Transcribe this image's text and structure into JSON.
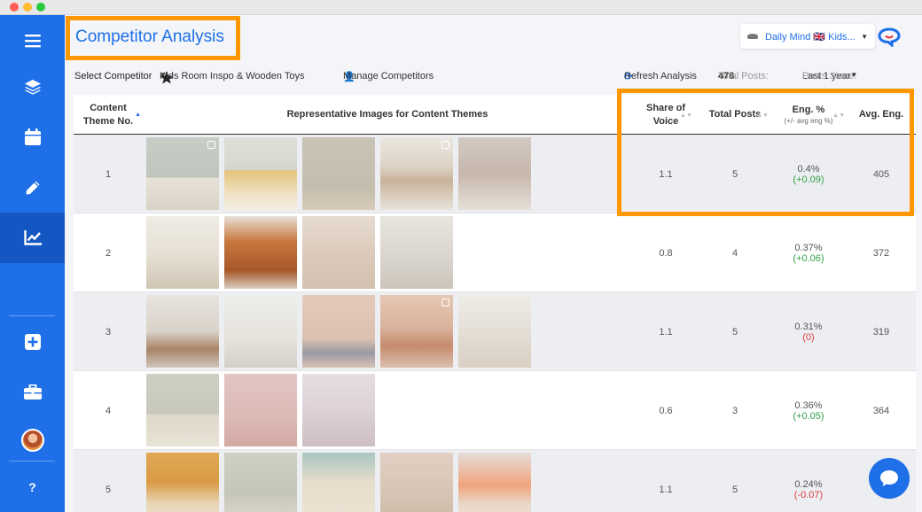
{
  "page": {
    "title": "Competitor Analysis"
  },
  "brand": {
    "name": "Daily Mind 🇬🇧 Kids..."
  },
  "toolbar": {
    "select_label": "Select Competitor",
    "competitor": "Kids Room Inspo & Wooden Toys",
    "manage": "Manage Competitors",
    "refresh": "Refresh Analysis",
    "total_label": "Total Posts:",
    "total_value": "476",
    "since_label": "Posts Since:",
    "since_value": "Last 1 year"
  },
  "table": {
    "headers": {
      "theme": "Content Theme No.",
      "images": "Representative Images for Content Themes",
      "share": "Share of Voice",
      "total": "Total Posts",
      "eng": "Eng. %",
      "eng_sub": "(+/- avg eng %)",
      "avg": "Avg. Eng."
    },
    "rows": [
      {
        "no": "1",
        "share": "1.1",
        "total": "5",
        "eng": "0.4%",
        "delta": "(+0.09)",
        "delta_dir": "pos",
        "avg": "405",
        "thumbs": [
          {
            "bg": "linear-gradient(180deg,#c9cdc6 0%,#bfc4bc 55%,#e7e2d8 56%,#d9d3c6 100%)",
            "multi": true
          },
          {
            "bg": "linear-gradient(180deg,#dfe0d8 0%,#d5d6cb 45%,#e4c37a 46%,#efe3c8 80%,#f4efe3 100%)",
            "multi": false
          },
          {
            "bg": "linear-gradient(180deg,#c9c3b7 0%,#c4beaf 70%,#d8cbb8 100%)",
            "multi": false
          },
          {
            "bg": "linear-gradient(180deg,#ebe7e1 0%,#ddd3c5 40%,#c9b39a 60%,#e8e3dc 100%)",
            "multi": true
          },
          {
            "bg": "linear-gradient(180deg,#d2c9c2 0%,#c7b7ac 50%,#e6dfd8 100%)",
            "multi": false
          }
        ]
      },
      {
        "no": "2",
        "share": "0.8",
        "total": "4",
        "eng": "0.37%",
        "delta": "(+0.06)",
        "delta_dir": "pos",
        "avg": "372",
        "thumbs": [
          {
            "bg": "linear-gradient(180deg,#efece4 0%,#e5dfd3 55%,#cfc5b3 100%)",
            "multi": false
          },
          {
            "bg": "linear-gradient(180deg,#e6e0d6 0%,#c8773d 35%,#a7582a 75%,#d9cfc0 100%)",
            "multi": false
          },
          {
            "bg": "linear-gradient(180deg,#e6dbd0 0%,#dccbbc 50%,#d3c0b0 100%)",
            "multi": false
          },
          {
            "bg": "linear-gradient(180deg,#e7e4de 0%,#dcd8d0 50%,#cbc5bb 100%)",
            "multi": false
          }
        ]
      },
      {
        "no": "3",
        "share": "1.1",
        "total": "5",
        "eng": "0.31%",
        "delta": "(0)",
        "delta_dir": "neg",
        "avg": "319",
        "thumbs": [
          {
            "bg": "linear-gradient(180deg,#e7e4de 0%,#d9d2c8 50%,#a88468 75%,#cfc6bc 100%)",
            "multi": false
          },
          {
            "bg": "linear-gradient(180deg,#efeeea 0%,#e6e3dd 60%,#d5d0c7 100%)",
            "multi": false
          },
          {
            "bg": "linear-gradient(180deg,#e3cabb 0%,#dcc1b1 60%,#9b9aa4 80%,#d7c3b6 100%)",
            "multi": false
          },
          {
            "bg": "linear-gradient(180deg,#e6c7b4 0%,#d9b29c 45%,#c58b6c 70%,#dcc0af 100%)",
            "multi": true
          },
          {
            "bg": "linear-gradient(180deg,#eeece7 0%,#e3ddd4 55%,#d9cfc2 100%)",
            "multi": false
          }
        ]
      },
      {
        "no": "4",
        "share": "0.6",
        "total": "3",
        "eng": "0.36%",
        "delta": "(+0.05)",
        "delta_dir": "pos",
        "avg": "364",
        "thumbs": [
          {
            "bg": "linear-gradient(180deg,#cfd0c4 0%,#c7c8bb 55%,#ddd8ca 56%,#e8e3d6 100%)",
            "multi": false
          },
          {
            "bg": "linear-gradient(180deg,#e3c6c2 0%,#dcbab6 60%,#d4a9a3 100%)",
            "multi": false
          },
          {
            "bg": "linear-gradient(180deg,#e7dee0 0%,#dcd0d3 55%,#cdbec2 100%)",
            "multi": false
          }
        ]
      },
      {
        "no": "5",
        "share": "1.1",
        "total": "5",
        "eng": "0.24%",
        "delta": "(-0.07)",
        "delta_dir": "neg",
        "avg": "",
        "thumbs": [
          {
            "bg": "linear-gradient(180deg,#e0a955 0%,#d99a44 40%,#e7d5b4 70%,#f0e7d8 100%)",
            "multi": false
          },
          {
            "bg": "linear-gradient(180deg,#cfd0c4 0%,#c5c6b8 55%,#e0dbcd 100%)",
            "multi": false
          },
          {
            "bg": "linear-gradient(180deg,#a8c6c0 0%,#e6dccb 40%,#ede5d6 100%)",
            "multi": false
          },
          {
            "bg": "linear-gradient(180deg,#e0d0c3 0%,#d8c4b4 55%,#cdb8a6 100%)",
            "multi": false
          },
          {
            "bg": "linear-gradient(180deg,#e6ddd9 0%,#f0a47c 45%,#e9d6c5 70%,#efe6dc 100%)",
            "multi": false
          }
        ]
      }
    ]
  },
  "colors": {
    "accent": "#1e6fe8",
    "highlight": "#ff9800",
    "positive": "#2ea043",
    "negative": "#e0403d"
  }
}
